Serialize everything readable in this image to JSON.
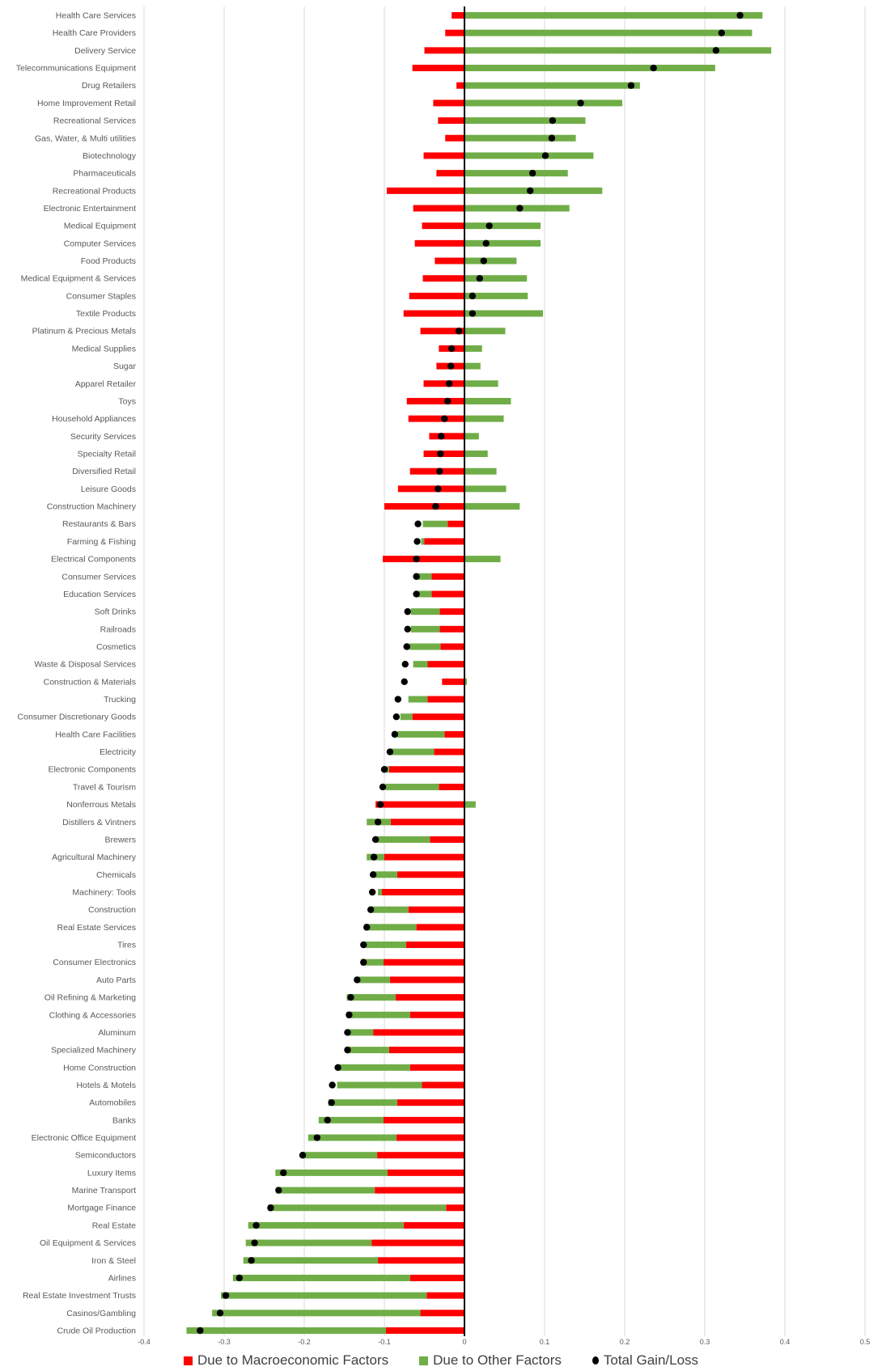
{
  "chart_data": {
    "type": "bar",
    "orientation": "horizontal",
    "stacked": true,
    "title": "",
    "xlabel": "",
    "ylabel": "",
    "xlim": [
      -0.4,
      0.5
    ],
    "xticks": [
      -0.4,
      -0.3,
      -0.2,
      -0.1,
      0,
      0.1,
      0.2,
      0.3,
      0.4,
      0.5
    ],
    "xtick_labels": [
      "-0.4",
      "-0.3",
      "-0.2",
      "-0.1",
      "0",
      "0.1",
      "0.2",
      "0.3",
      "0.4",
      "0.5"
    ],
    "grid": "vertical",
    "legend_position": "bottom",
    "colors": {
      "macro": "#ff0000",
      "other": "#70ad47",
      "total": "#000000",
      "zero_line": "#000000",
      "grid": "#d9d9d9"
    },
    "legend": [
      {
        "key": "macro",
        "label": "Due to Macroeconomic Factors",
        "marker": "square"
      },
      {
        "key": "other",
        "label": "Due to Other Factors",
        "marker": "square"
      },
      {
        "key": "total",
        "label": "Total Gain/Loss",
        "marker": "circle"
      }
    ],
    "categories": [
      "Health Care Services",
      "Health Care Providers",
      "Delivery Service",
      "Telecommunications Equipment",
      "Drug Retailers",
      "Home Improvement  Retail",
      "Recreational Services",
      "Gas, Water, & Multi utilities",
      "Biotechnology",
      "Pharmaceuticals",
      "Recreational Products",
      "Electronic Entertainment",
      "Medical Equipment",
      "Computer Services",
      "Food Products",
      "Medical Equipment &  Services",
      "Consumer Staples",
      "Textile Products",
      "Platinum & Precious Metals",
      "Medical Supplies",
      "Sugar",
      "Apparel Retailer",
      "Toys",
      "Household Appliances",
      "Security Services",
      "Specialty Retail",
      "Diversified Retail",
      "Leisure Goods",
      "Construction Machinery",
      "Restaurants & Bars",
      "Farming & Fishing",
      "Electrical Components",
      "Consumer Services",
      "Education Services",
      "Soft Drinks",
      "Railroads",
      "Cosmetics",
      "Waste & Disposal  Services",
      "Construction &  Materials",
      "Trucking",
      "Consumer Discretionary Goods",
      "Health Care Facilities",
      "Electricity",
      "Electronic Components",
      "Travel & Tourism",
      "Nonferrous Metals",
      "Distillers & Vintners",
      "Brewers",
      "Agricultural  Machinery",
      "Chemicals",
      "Machinery: Tools",
      "Construction",
      "Real Estate Services",
      "Tires",
      "Consumer Electronics",
      "Auto Parts",
      "Oil Refining & Marketing",
      "Clothing &  Accessories",
      "Aluminum",
      "Specialized Machinery",
      "Home Construction",
      "Hotels & Motels",
      "Automobiles",
      "Banks",
      "Electronic Office  Equipment",
      "Semiconductors",
      "Luxury Items",
      "Marine Transport",
      "Mortgage Finance",
      "Real Estate",
      "Oil Equipment & Services",
      "Iron & Steel",
      "Airlines",
      "Real Estate Investment  Trusts",
      "Casinos/Gambling",
      "Crude Oil Production"
    ],
    "series": [
      {
        "name": "Due to Macroeconomic Factors",
        "key": "macro",
        "values": [
          -0.016,
          -0.024,
          -0.05,
          -0.065,
          -0.01,
          -0.039,
          -0.033,
          -0.024,
          -0.051,
          -0.035,
          -0.097,
          -0.064,
          -0.053,
          -0.062,
          -0.037,
          -0.052,
          -0.069,
          -0.076,
          -0.055,
          -0.032,
          -0.035,
          -0.051,
          -0.072,
          -0.07,
          -0.044,
          -0.051,
          -0.068,
          -0.083,
          -0.1,
          -0.021,
          -0.05,
          -0.102,
          -0.041,
          -0.041,
          -0.031,
          -0.031,
          -0.03,
          -0.046,
          -0.028,
          -0.046,
          -0.065,
          -0.025,
          -0.038,
          -0.094,
          -0.032,
          -0.111,
          -0.092,
          -0.043,
          -0.1,
          -0.084,
          -0.103,
          -0.07,
          -0.06,
          -0.073,
          -0.101,
          -0.093,
          -0.086,
          -0.068,
          -0.114,
          -0.094,
          -0.068,
          -0.053,
          -0.084,
          -0.101,
          -0.085,
          -0.109,
          -0.096,
          -0.112,
          -0.023,
          -0.076,
          -0.116,
          -0.108,
          -0.068,
          -0.047,
          -0.055,
          -0.098
        ]
      },
      {
        "name": "Due to Other Factors",
        "key": "other",
        "values": [
          0.372,
          0.359,
          0.383,
          0.313,
          0.219,
          0.197,
          0.151,
          0.139,
          0.161,
          0.129,
          0.172,
          0.131,
          0.095,
          0.095,
          0.065,
          0.078,
          0.079,
          0.098,
          0.051,
          0.022,
          0.02,
          0.042,
          0.058,
          0.049,
          0.018,
          0.029,
          0.04,
          0.052,
          0.069,
          -0.031,
          -0.004,
          0.045,
          -0.017,
          -0.017,
          -0.036,
          -0.036,
          -0.039,
          -0.018,
          0.003,
          -0.024,
          -0.015,
          -0.059,
          -0.055,
          -0.004,
          -0.067,
          0.014,
          -0.03,
          -0.068,
          -0.022,
          -0.03,
          -0.005,
          -0.047,
          -0.065,
          -0.054,
          -0.028,
          -0.041,
          -0.061,
          -0.079,
          -0.032,
          -0.052,
          -0.09,
          -0.106,
          -0.086,
          -0.081,
          -0.11,
          -0.095,
          -0.14,
          -0.123,
          -0.222,
          -0.194,
          -0.157,
          -0.168,
          -0.221,
          -0.257,
          -0.26,
          -0.249
        ]
      },
      {
        "name": "Total Gain/Loss",
        "key": "total",
        "values": [
          0.344,
          0.321,
          0.314,
          0.236,
          0.208,
          0.145,
          0.11,
          0.109,
          0.101,
          0.085,
          0.082,
          0.069,
          0.031,
          0.027,
          0.024,
          0.019,
          0.01,
          0.01,
          -0.007,
          -0.016,
          -0.017,
          -0.019,
          -0.021,
          -0.025,
          -0.029,
          -0.03,
          -0.031,
          -0.033,
          -0.036,
          -0.058,
          -0.059,
          -0.06,
          -0.06,
          -0.06,
          -0.071,
          -0.071,
          -0.072,
          -0.074,
          -0.075,
          -0.083,
          -0.085,
          -0.087,
          -0.093,
          -0.1,
          -0.102,
          -0.105,
          -0.108,
          -0.111,
          -0.113,
          -0.114,
          -0.115,
          -0.117,
          -0.122,
          -0.126,
          -0.126,
          -0.134,
          -0.142,
          -0.144,
          -0.146,
          -0.146,
          -0.158,
          -0.165,
          -0.166,
          -0.171,
          -0.184,
          -0.202,
          -0.226,
          -0.232,
          -0.242,
          -0.26,
          -0.262,
          -0.266,
          -0.281,
          -0.298,
          -0.305,
          -0.33
        ]
      }
    ]
  }
}
